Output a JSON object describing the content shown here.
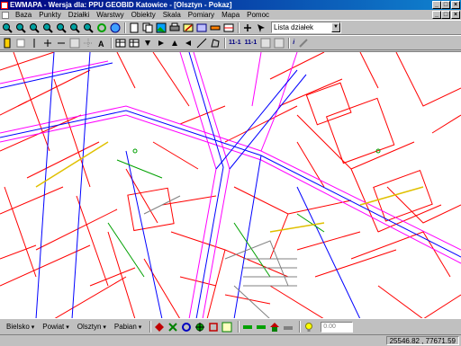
{
  "window": {
    "title": "EWMAPA - Wersja dla: PPU GEOBID Katowice - [Olsztyn - Pokaz]",
    "minimize": "_",
    "maximize": "□",
    "close": "×"
  },
  "menu": {
    "items": [
      "Baza",
      "Punkty",
      "Działki",
      "Warstwy",
      "Obiekty",
      "Skala",
      "Pomiary",
      "Mapa",
      "Pomoc"
    ]
  },
  "toolbar": {
    "icons1": [
      "zoom-in-icon",
      "zoom-out-icon",
      "zoom-window-icon",
      "zoom-prev-icon",
      "zoom-all-icon",
      "zoom-next-icon",
      "zoom-area-icon",
      "refresh-icon",
      "globe-icon",
      "document-icon",
      "copy-icon",
      "image-icon",
      "printer-icon",
      "edit-icon",
      "database-icon",
      "ruler-icon",
      "layers-icon",
      "move-icon",
      "pointer-icon"
    ],
    "parcel_list": "Lista działek",
    "icons2": [
      "key-icon",
      "layer-icon",
      "vertical-line-icon",
      "cross-icon",
      "minus-icon",
      "grid-icon",
      "select-icon",
      "text-icon",
      "table-icon",
      "table2-icon",
      "arrow-down-icon",
      "arrow-right-icon",
      "arrow-up-icon",
      "arrow-left-icon",
      "line-icon",
      "polygon-icon"
    ],
    "label_111": "11-1",
    "label_111b": "11-1",
    "info": "i"
  },
  "bottombar": {
    "dropdowns": [
      "Bielsko",
      "Powiat",
      "Olsztyn",
      "Pabian"
    ],
    "scale_value": "0.00"
  },
  "status": {
    "coords": "25546.82 , 77671.59"
  },
  "colors": {
    "titlebar": "#000080",
    "parcel_lines": "#ff0000",
    "utility_lines": "#0000ff",
    "road_lines": "#ff00ff",
    "map_background": "#ffffff"
  }
}
